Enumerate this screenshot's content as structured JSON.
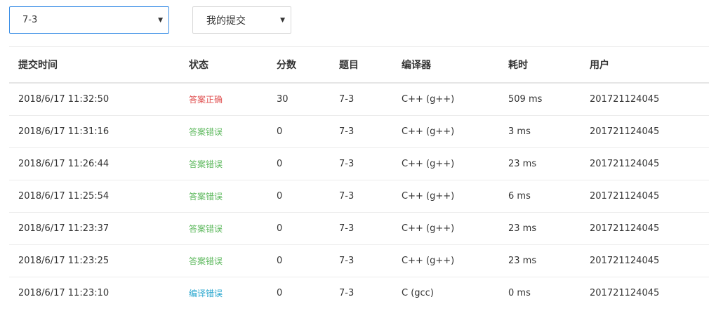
{
  "filters": {
    "problem_select": {
      "value": "7-3"
    },
    "scope_select": {
      "value": "我的提交"
    }
  },
  "table": {
    "headers": [
      "提交时间",
      "状态",
      "分数",
      "题目",
      "编译器",
      "耗时",
      "用户"
    ],
    "rows": [
      {
        "time": "2018/6/17 11:32:50",
        "status": "答案正确",
        "status_color": "#e05050",
        "score": "30",
        "problem": "7-3",
        "compiler": "C++ (g++)",
        "duration": "509 ms",
        "user": "201721124045"
      },
      {
        "time": "2018/6/17 11:31:16",
        "status": "答案错误",
        "status_color": "#5cb85c",
        "score": "0",
        "problem": "7-3",
        "compiler": "C++ (g++)",
        "duration": "3 ms",
        "user": "201721124045"
      },
      {
        "time": "2018/6/17 11:26:44",
        "status": "答案错误",
        "status_color": "#5cb85c",
        "score": "0",
        "problem": "7-3",
        "compiler": "C++ (g++)",
        "duration": "23 ms",
        "user": "201721124045"
      },
      {
        "time": "2018/6/17 11:25:54",
        "status": "答案错误",
        "status_color": "#5cb85c",
        "score": "0",
        "problem": "7-3",
        "compiler": "C++ (g++)",
        "duration": "6 ms",
        "user": "201721124045"
      },
      {
        "time": "2018/6/17 11:23:37",
        "status": "答案错误",
        "status_color": "#5cb85c",
        "score": "0",
        "problem": "7-3",
        "compiler": "C++ (g++)",
        "duration": "23 ms",
        "user": "201721124045"
      },
      {
        "time": "2018/6/17 11:23:25",
        "status": "答案错误",
        "status_color": "#5cb85c",
        "score": "0",
        "problem": "7-3",
        "compiler": "C++ (g++)",
        "duration": "23 ms",
        "user": "201721124045"
      },
      {
        "time": "2018/6/17 11:23:10",
        "status": "编译错误",
        "status_color": "#2aa7cf",
        "score": "0",
        "problem": "7-3",
        "compiler": "C (gcc)",
        "duration": "0 ms",
        "user": "201721124045"
      }
    ]
  }
}
